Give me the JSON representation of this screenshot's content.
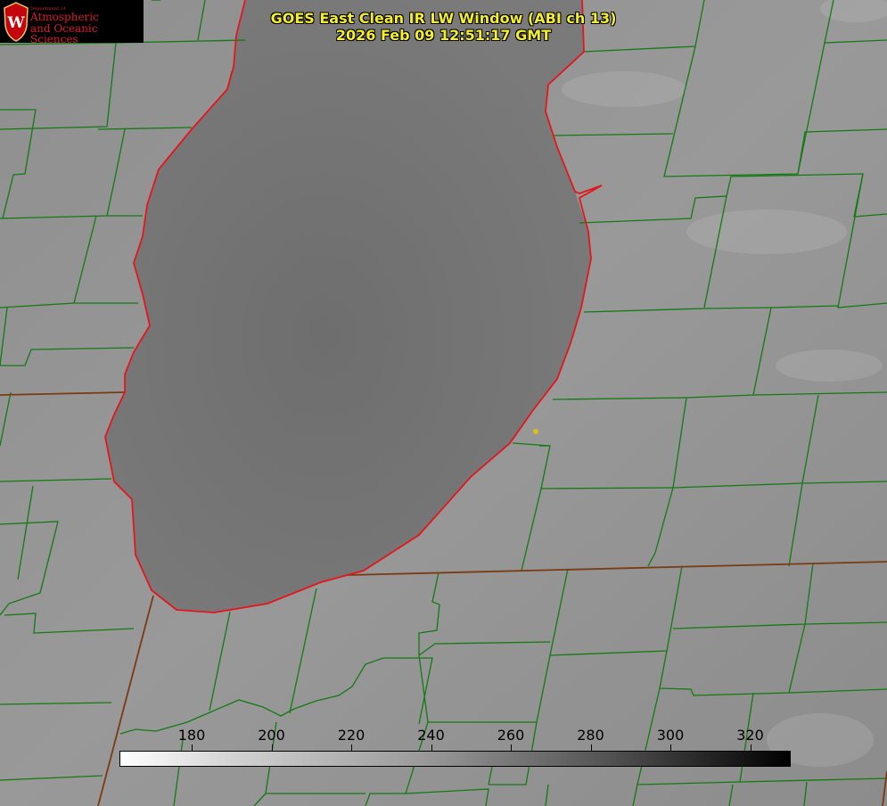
{
  "logo": {
    "dept_small": "Department of",
    "line1": "Atmospheric",
    "line2": "and Oceanic Sciences",
    "shield_letter": "W"
  },
  "title": {
    "line1": "GOES East Clean IR LW Window (ABI ch 13)",
    "line2": "2026 Feb 09 12:51:17 GMT"
  },
  "colorbar": {
    "ticks": [
      "180",
      "200",
      "220",
      "240",
      "260",
      "280",
      "300",
      "320"
    ]
  },
  "colors": {
    "county_lines": "#137a13",
    "lake_outline": "#e4161b",
    "state_border": "#7a3a12",
    "marker": "#d8c21a",
    "title": "#f4ef2a"
  }
}
